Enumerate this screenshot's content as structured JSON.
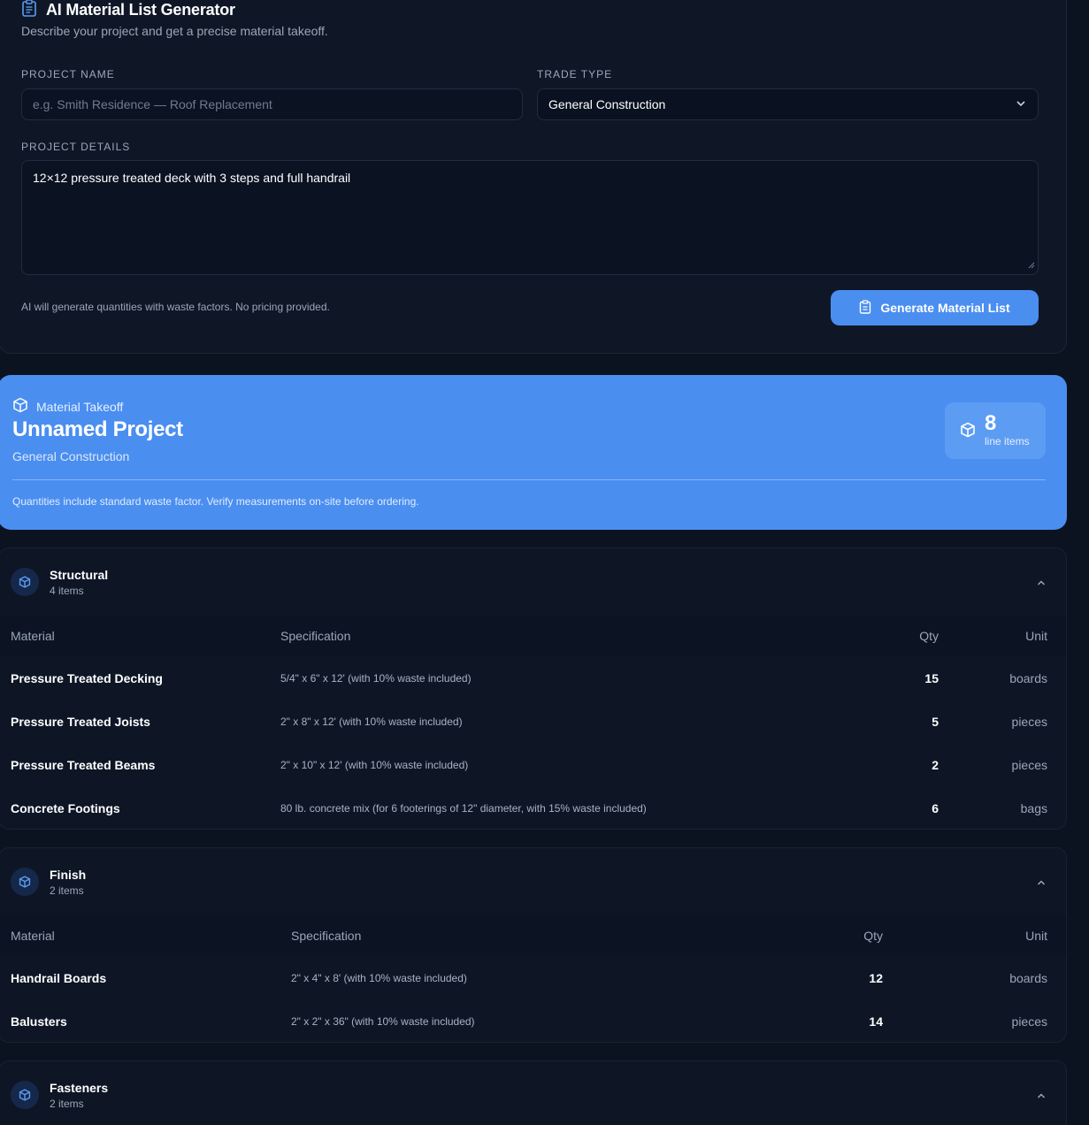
{
  "generator": {
    "title": "AI Material List Generator",
    "subtitle": "Describe your project and get a precise material takeoff.",
    "project_name_label": "PROJECT NAME",
    "project_name_placeholder": "e.g. Smith Residence — Roof Replacement",
    "trade_type_label": "TRADE TYPE",
    "trade_type_value": "General Construction",
    "details_label": "PROJECT DETAILS",
    "details_value": "12×12 pressure treated deck with 3 steps and full handrail",
    "hint": "AI will generate quantities with waste factors. No pricing provided.",
    "generate_button": "Generate Material List"
  },
  "takeoff": {
    "label": "Material Takeoff",
    "project_title": "Unnamed Project",
    "trade": "General Construction",
    "count": "8",
    "count_label": "line items",
    "note": "Quantities include standard waste factor. Verify measurements on-site before ordering."
  },
  "columns": {
    "material": "Material",
    "specification": "Specification",
    "qty": "Qty",
    "unit": "Unit"
  },
  "categories": [
    {
      "name": "Structural",
      "count": "4 items",
      "rows": [
        {
          "material": "Pressure Treated Decking",
          "spec": "5/4\" x 6\" x 12' (with 10% waste included)",
          "qty": "15",
          "unit": "boards"
        },
        {
          "material": "Pressure Treated Joists",
          "spec": "2\" x 8\" x 12' (with 10% waste included)",
          "qty": "5",
          "unit": "pieces"
        },
        {
          "material": "Pressure Treated Beams",
          "spec": "2\" x 10\" x 12' (with 10% waste included)",
          "qty": "2",
          "unit": "pieces"
        },
        {
          "material": "Concrete Footings",
          "spec": "80 lb. concrete mix (for 6 footerings of 12\" diameter, with 15% waste included)",
          "qty": "6",
          "unit": "bags"
        }
      ]
    },
    {
      "name": "Finish",
      "count": "2 items",
      "rows": [
        {
          "material": "Handrail Boards",
          "spec": "2\" x 4\" x 8' (with 10% waste included)",
          "qty": "12",
          "unit": "boards"
        },
        {
          "material": "Balusters",
          "spec": "2\" x 2\" x 36\" (with 10% waste included)",
          "qty": "14",
          "unit": "pieces"
        }
      ]
    },
    {
      "name": "Fasteners",
      "count": "2 items",
      "rows": []
    }
  ],
  "colors": {
    "background": "#0b1220",
    "card": "#0f1727",
    "accent": "#4a8ef0"
  }
}
